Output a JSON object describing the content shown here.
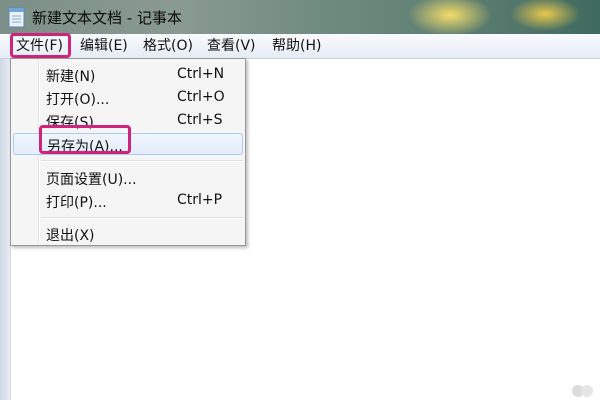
{
  "window": {
    "title": "新建文本文档 - 记事本",
    "icon": "notepad-icon"
  },
  "menubar": {
    "items": [
      {
        "label": "文件(F)",
        "highlighted": true
      },
      {
        "label": "编辑(E)"
      },
      {
        "label": "格式(O)"
      },
      {
        "label": "查看(V)"
      },
      {
        "label": "帮助(H)"
      }
    ]
  },
  "file_menu": {
    "items": [
      {
        "label": "新建(N)",
        "shortcut": "Ctrl+N"
      },
      {
        "label": "打开(O)...",
        "shortcut": "Ctrl+O"
      },
      {
        "label": "保存(S)",
        "shortcut": "Ctrl+S"
      },
      {
        "label": "另存为(A)...",
        "shortcut": "",
        "hovered": true,
        "highlighted": true
      },
      {
        "label": "页面设置(U)...",
        "shortcut": ""
      },
      {
        "label": "打印(P)...",
        "shortcut": "Ctrl+P"
      },
      {
        "label": "退出(X)",
        "shortcut": ""
      }
    ]
  },
  "editor": {
    "content": ""
  },
  "colors": {
    "annotation": "#d0247a",
    "menu_hover_border": "#aecaf0",
    "menubar_bg": "#e6ecf5"
  }
}
